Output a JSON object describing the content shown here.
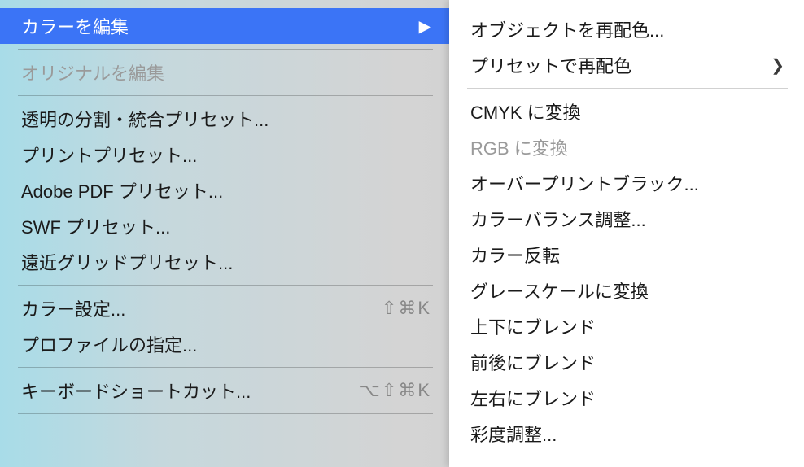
{
  "leftMenu": {
    "groups": [
      {
        "items": [
          {
            "id": "edit-colors",
            "label": "カラーを編集",
            "hasSubmenu": true,
            "highlighted": true,
            "enabled": true
          },
          {
            "id": "edit-original",
            "label": "オリジナルを編集",
            "enabled": false
          }
        ]
      },
      {
        "items": [
          {
            "id": "flattener-preset",
            "label": "透明の分割・統合プリセット...",
            "enabled": true
          },
          {
            "id": "print-preset",
            "label": "プリントプリセット...",
            "enabled": true
          },
          {
            "id": "pdf-preset",
            "label": "Adobe PDF プリセット...",
            "enabled": true
          },
          {
            "id": "swf-preset",
            "label": "SWF プリセット...",
            "enabled": true
          },
          {
            "id": "perspective-preset",
            "label": "遠近グリッドプリセット...",
            "enabled": true
          }
        ]
      },
      {
        "items": [
          {
            "id": "color-settings",
            "label": "カラー設定...",
            "enabled": true,
            "shortcut": "⇧⌘K"
          },
          {
            "id": "assign-profile",
            "label": "プロファイルの指定...",
            "enabled": true
          }
        ]
      },
      {
        "items": [
          {
            "id": "keyboard-shortcuts",
            "label": "キーボードショートカット...",
            "enabled": true,
            "shortcut": "⌥⇧⌘K"
          }
        ]
      }
    ]
  },
  "submenu": {
    "groups": [
      {
        "items": [
          {
            "id": "recolor-artwork",
            "label": "オブジェクトを再配色...",
            "enabled": true
          },
          {
            "id": "recolor-preset",
            "label": "プリセットで再配色",
            "hasSubmenu": true,
            "enabled": true
          }
        ]
      },
      {
        "items": [
          {
            "id": "convert-cmyk",
            "label": "CMYK に変換",
            "enabled": true
          },
          {
            "id": "convert-rgb",
            "label": "RGB に変換",
            "enabled": false
          },
          {
            "id": "overprint-black",
            "label": "オーバープリントブラック...",
            "enabled": true
          },
          {
            "id": "adjust-color-balance",
            "label": "カラーバランス調整...",
            "enabled": true
          },
          {
            "id": "invert-colors",
            "label": "カラー反転",
            "enabled": true
          },
          {
            "id": "convert-grayscale",
            "label": "グレースケールに変換",
            "enabled": true
          },
          {
            "id": "blend-vertical",
            "label": "上下にブレンド",
            "enabled": true
          },
          {
            "id": "blend-front-back",
            "label": "前後にブレンド",
            "enabled": true
          },
          {
            "id": "blend-horizontal",
            "label": "左右にブレンド",
            "enabled": true
          },
          {
            "id": "saturate",
            "label": "彩度調整...",
            "enabled": true
          }
        ]
      }
    ]
  }
}
